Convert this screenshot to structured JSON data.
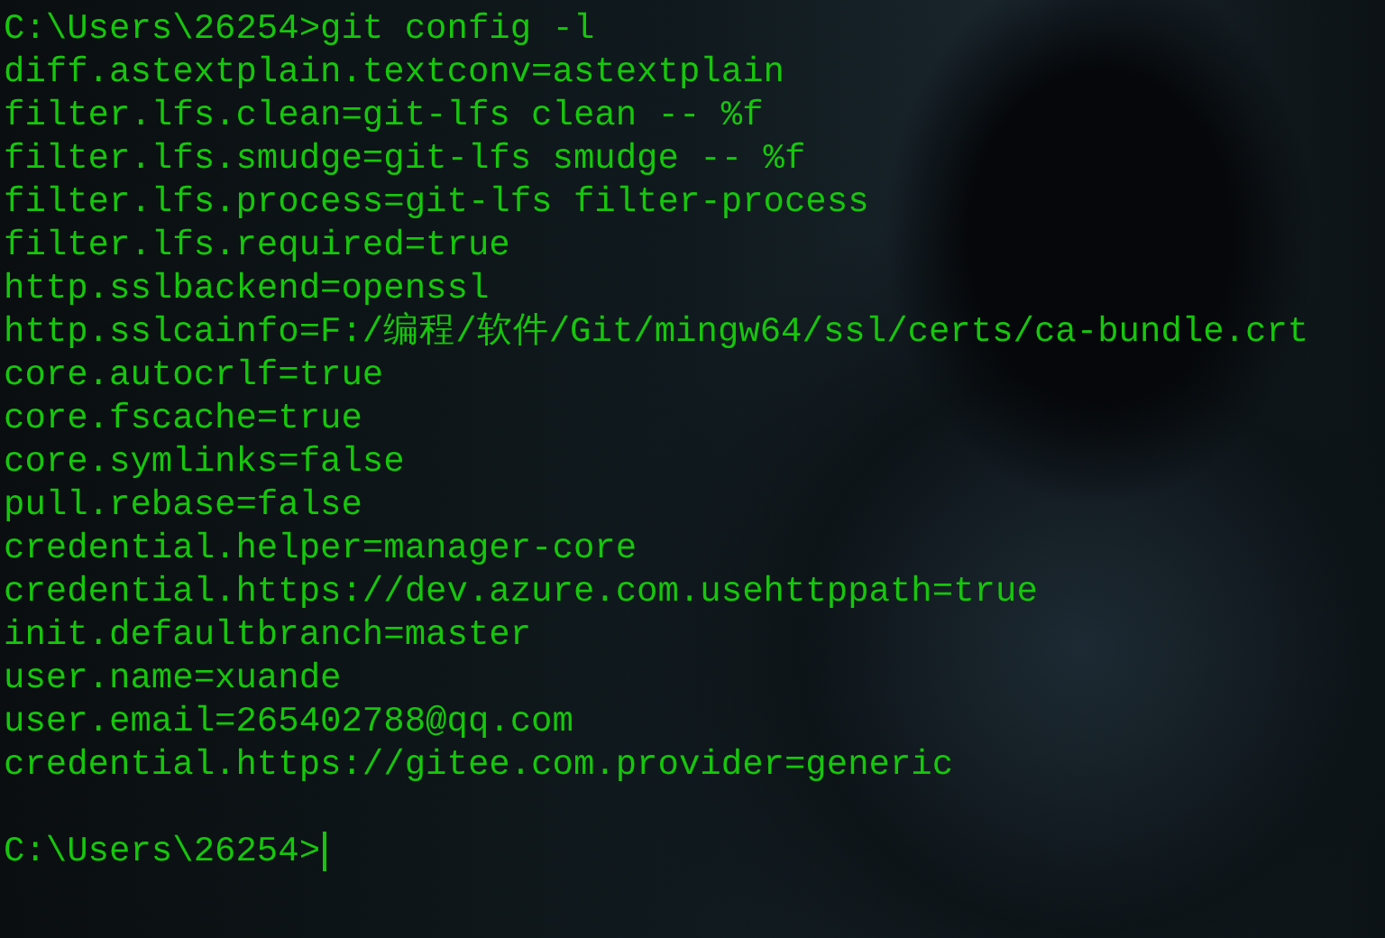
{
  "terminal": {
    "command_line": "C:\\Users\\26254>git config -l",
    "output": [
      "diff.astextplain.textconv=astextplain",
      "filter.lfs.clean=git-lfs clean -- %f",
      "filter.lfs.smudge=git-lfs smudge -- %f",
      "filter.lfs.process=git-lfs filter-process",
      "filter.lfs.required=true",
      "http.sslbackend=openssl",
      "http.sslcainfo=F:/编程/软件/Git/mingw64/ssl/certs/ca-bundle.crt",
      "core.autocrlf=true",
      "core.fscache=true",
      "core.symlinks=false",
      "pull.rebase=false",
      "credential.helper=manager-core",
      "credential.https://dev.azure.com.usehttppath=true",
      "init.defaultbranch=master",
      "user.name=xuande",
      "user.email=265402788@qq.com",
      "credential.https://gitee.com.provider=generic"
    ],
    "prompt": "C:\\Users\\26254>"
  }
}
